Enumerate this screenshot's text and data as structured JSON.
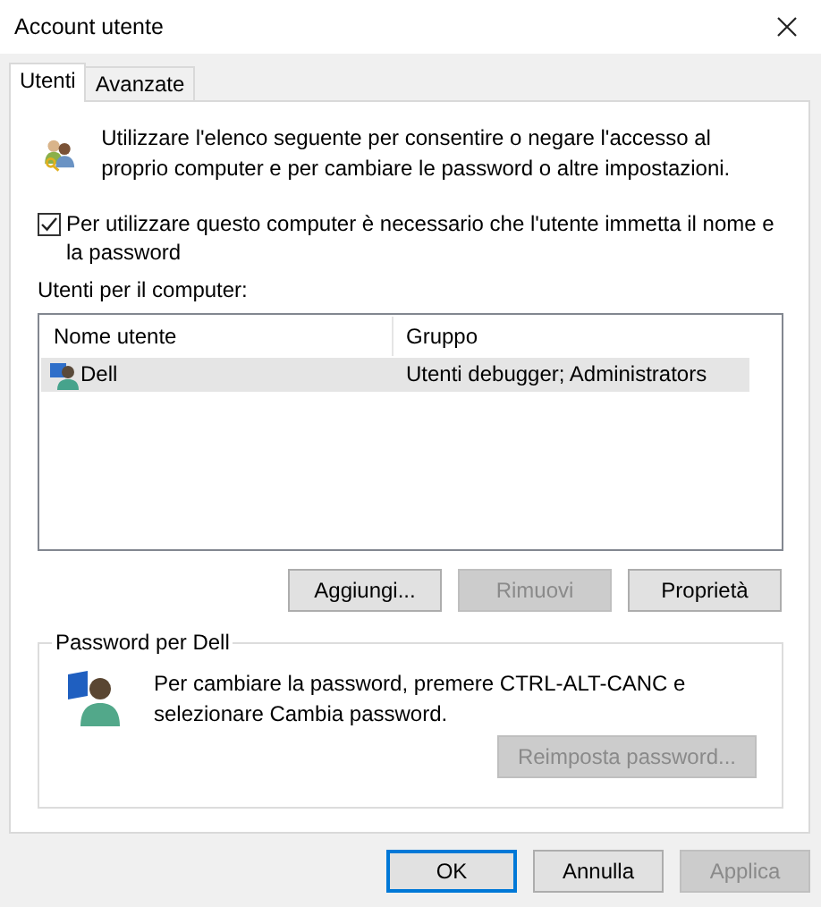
{
  "window": {
    "title": "Account utente"
  },
  "tabs": [
    {
      "label": "Utenti",
      "selected": true
    },
    {
      "label": "Avanzate",
      "selected": false
    }
  ],
  "intro": "Utilizzare l'elenco seguente per consentire o negare l'accesso al proprio computer e per cambiare le password o altre impostazioni.",
  "require_login": {
    "label": "Per utilizzare questo computer è necessario che l'utente immetta il nome e la password",
    "checked": true
  },
  "users_label": "Utenti per il computer:",
  "table": {
    "columns": [
      "Nome utente",
      "Gruppo"
    ],
    "rows": [
      {
        "name": "Dell",
        "group": "Utenti debugger; Administrators",
        "selected": true
      }
    ]
  },
  "list_buttons": [
    {
      "label": "Aggiungi...",
      "disabled": false
    },
    {
      "label": "Rimuovi",
      "disabled": true
    },
    {
      "label": "Proprietà",
      "disabled": false
    }
  ],
  "password_group": {
    "title": "Password per Dell",
    "text": "Per cambiare la password, premere CTRL-ALT-CANC e selezionare Cambia password.",
    "button": {
      "label": "Reimposta password...",
      "disabled": true
    }
  },
  "dialog_buttons": [
    {
      "label": "OK",
      "disabled": false,
      "default": true
    },
    {
      "label": "Annulla",
      "disabled": false,
      "default": false
    },
    {
      "label": "Applica",
      "disabled": true,
      "default": false
    }
  ]
}
